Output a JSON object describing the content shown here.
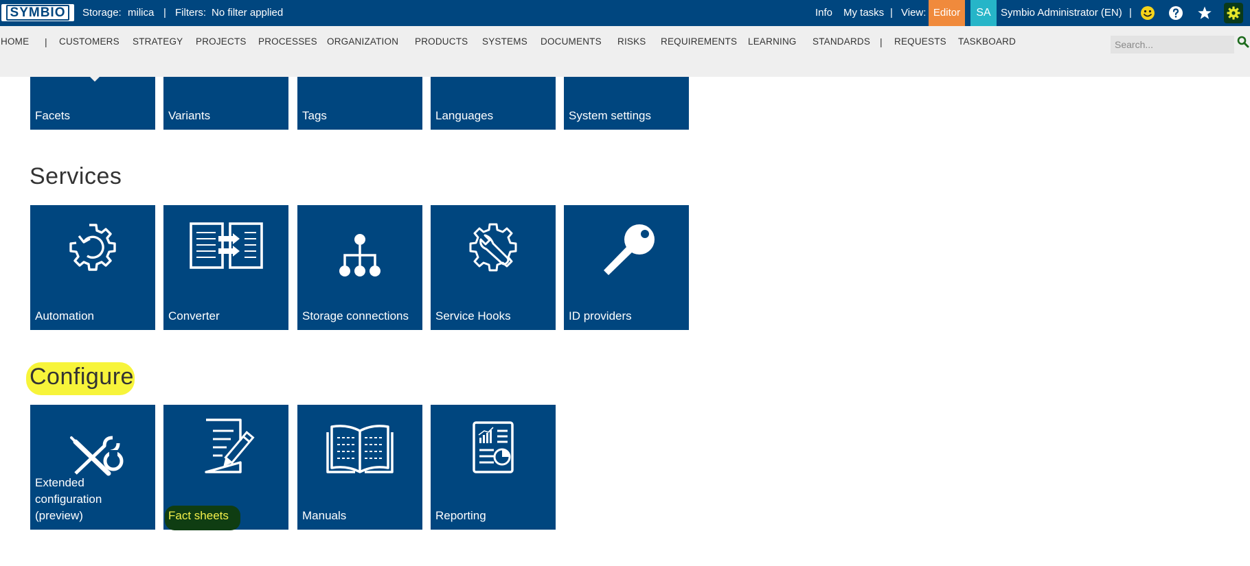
{
  "topbar": {
    "logo": "SYMBIO",
    "storage_label": "Storage:",
    "storage_value": "milica",
    "sep1": "|",
    "filters_label": "Filters:",
    "filters_value": "No filter applied",
    "info": "Info",
    "my_tasks": "My tasks",
    "sep2": "|",
    "view_label": "View:",
    "view_value": "Editor",
    "avatar_initials": "SA",
    "user_name": "Symbio Administrator (EN)",
    "sep3": "|",
    "icons": [
      "smiley-icon",
      "help-icon",
      "star-icon",
      "settings-gear-icon"
    ]
  },
  "nav": {
    "items": [
      "HOME",
      "CUSTOMERS",
      "STRATEGY",
      "PROJECTS",
      "PROCESSES",
      "ORGANIZATION",
      "PRODUCTS",
      "SYSTEMS",
      "DOCUMENTS",
      "RISKS",
      "REQUIREMENTS",
      "LEARNING",
      "STANDARDS",
      "REQUESTS",
      "TASKBOARD"
    ],
    "separator": "|",
    "search_placeholder": "Search..."
  },
  "top_tiles": [
    "Facets",
    "Variants",
    "Tags",
    "Languages",
    "System settings"
  ],
  "services": {
    "title": "Services",
    "tiles": [
      {
        "label": "Automation",
        "icon": "automation-gear-icon"
      },
      {
        "label": "Converter",
        "icon": "converter-icon"
      },
      {
        "label": "Storage connections",
        "icon": "hierarchy-icon"
      },
      {
        "label": "Service Hooks",
        "icon": "gear-wrench-icon"
      },
      {
        "label": "ID providers",
        "icon": "key-icon"
      }
    ]
  },
  "configure": {
    "title": "Configure",
    "tiles": [
      {
        "label": "Extended configuration (preview)",
        "icon": "tools-icon"
      },
      {
        "label": "Fact sheets",
        "icon": "document-pencil-icon"
      },
      {
        "label": "Manuals",
        "icon": "book-icon"
      },
      {
        "label": "Reporting",
        "icon": "report-icon"
      }
    ]
  },
  "colors": {
    "brand_blue": "#00467f",
    "editor_orange": "#f08a3c",
    "avatar_teal": "#26b5c8",
    "highlight_yellow": "#f7f43a",
    "highlight_green": "#0f3d12"
  }
}
